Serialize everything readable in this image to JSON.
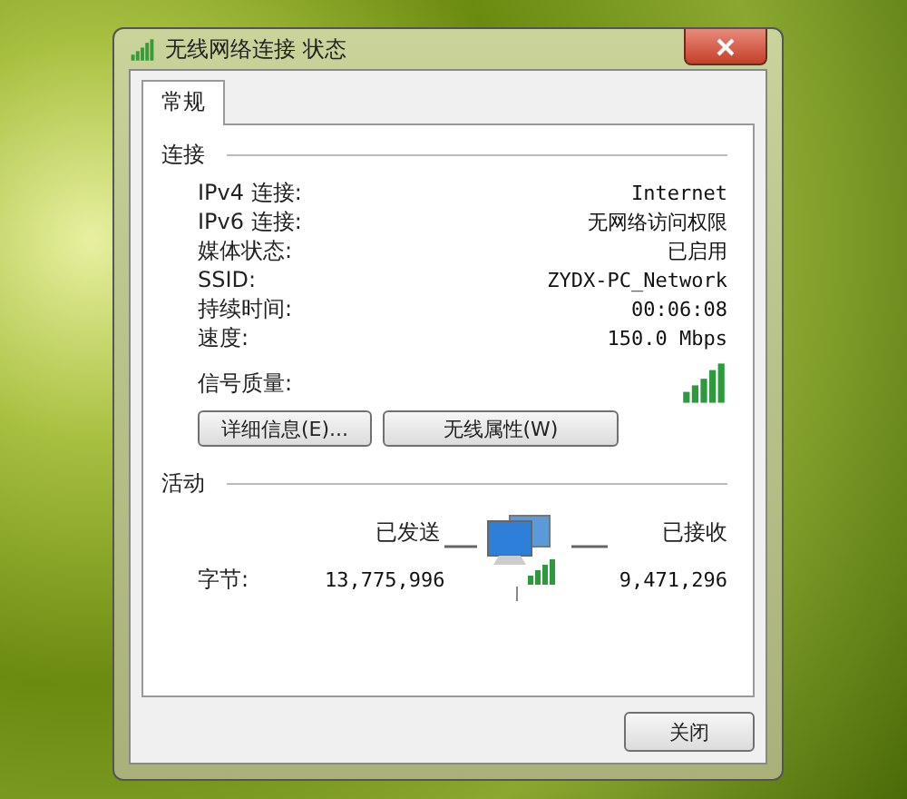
{
  "window": {
    "title": "无线网络连接 状态"
  },
  "tabs": [
    {
      "label": "常规",
      "selected": true
    }
  ],
  "connection": {
    "heading": "连接",
    "rows": [
      {
        "label": "IPv4 连接:",
        "value": "Internet"
      },
      {
        "label": "IPv6 连接:",
        "value": "无网络访问权限"
      },
      {
        "label": "媒体状态:",
        "value": "已启用"
      },
      {
        "label": "SSID:",
        "value": "ZYDX-PC_Network"
      },
      {
        "label": "持续时间:",
        "value": "00:06:08"
      },
      {
        "label": "速度:",
        "value": "150.0 Mbps"
      }
    ],
    "signal_label": "信号质量:"
  },
  "buttons": [
    "详细信息(E)...",
    "无线属性(W)"
  ],
  "activity": {
    "heading": "活动",
    "sent_label": "已发送",
    "received_label": "已接收",
    "rows": [
      {
        "label": "字节:",
        "sent": "13,775,996",
        "received": "9,471,296"
      }
    ]
  },
  "footer_buttons": [
    "关闭"
  ]
}
